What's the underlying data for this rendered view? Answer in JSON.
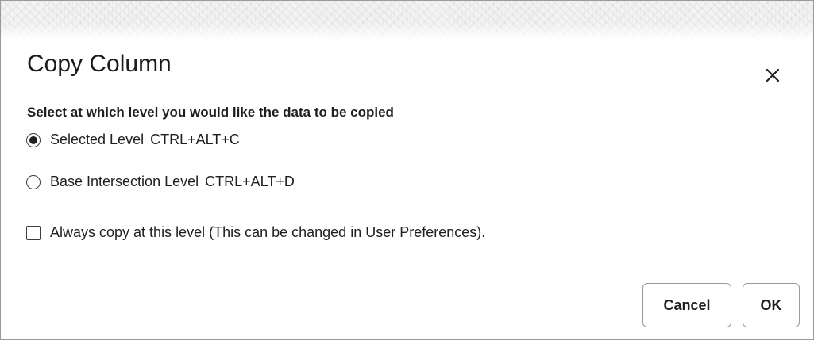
{
  "dialog": {
    "title": "Copy Column",
    "close_icon": "close-icon",
    "prompt": "Select at which level you would like the data to be copied",
    "options": [
      {
        "label": "Selected Level",
        "shortcut": "CTRL+ALT+C",
        "selected": true
      },
      {
        "label": "Base Intersection Level",
        "shortcut": "CTRL+ALT+D",
        "selected": false
      }
    ],
    "always_copy": {
      "label": "Always copy at this level (This can be changed in User Preferences).",
      "checked": false
    },
    "buttons": {
      "cancel": "Cancel",
      "ok": "OK"
    }
  }
}
